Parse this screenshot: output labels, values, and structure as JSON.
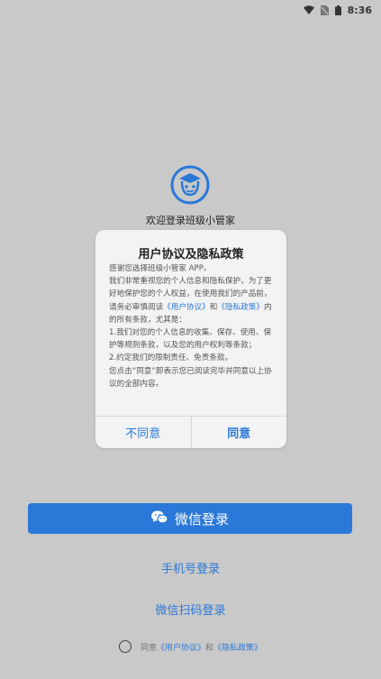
{
  "status_bar": {
    "time": "8:36"
  },
  "app": {
    "welcome": "欢迎登录班级小管家"
  },
  "dialog": {
    "title": "用户协议及隐私政策",
    "line1": "感谢您选择班级小管家 APP。",
    "line2a": "我们非常重视您的个人信息和隐私保护，为了更好地保护您的个人权益，在使用我们的产品前，请务必审慎阅读",
    "link_user": "《用户协议》",
    "and": "和",
    "link_privacy": "《隐私政策》",
    "line2b": "内的所有条款，尤其是：",
    "item1": "1.我们对您的个人信息的收集、保存、使用、保护等规则条款，以及您的用户权利等条款；",
    "item2": "2.约定我们的限制责任、免责条款。",
    "footer_text": "您点击“同意”即表示您已阅读完毕并同意以上协议的全部内容。",
    "disagree": "不同意",
    "agree": "同意"
  },
  "login": {
    "wechat": "微信登录",
    "phone": "手机号登录",
    "scan": "微信扫码登录"
  },
  "agreement": {
    "prefix": "同意",
    "user": "《用户协议》",
    "and": "和",
    "privacy": "《隐私政策》"
  },
  "colors": {
    "accent": "#2a78d8",
    "background": "#c9c9c9"
  }
}
